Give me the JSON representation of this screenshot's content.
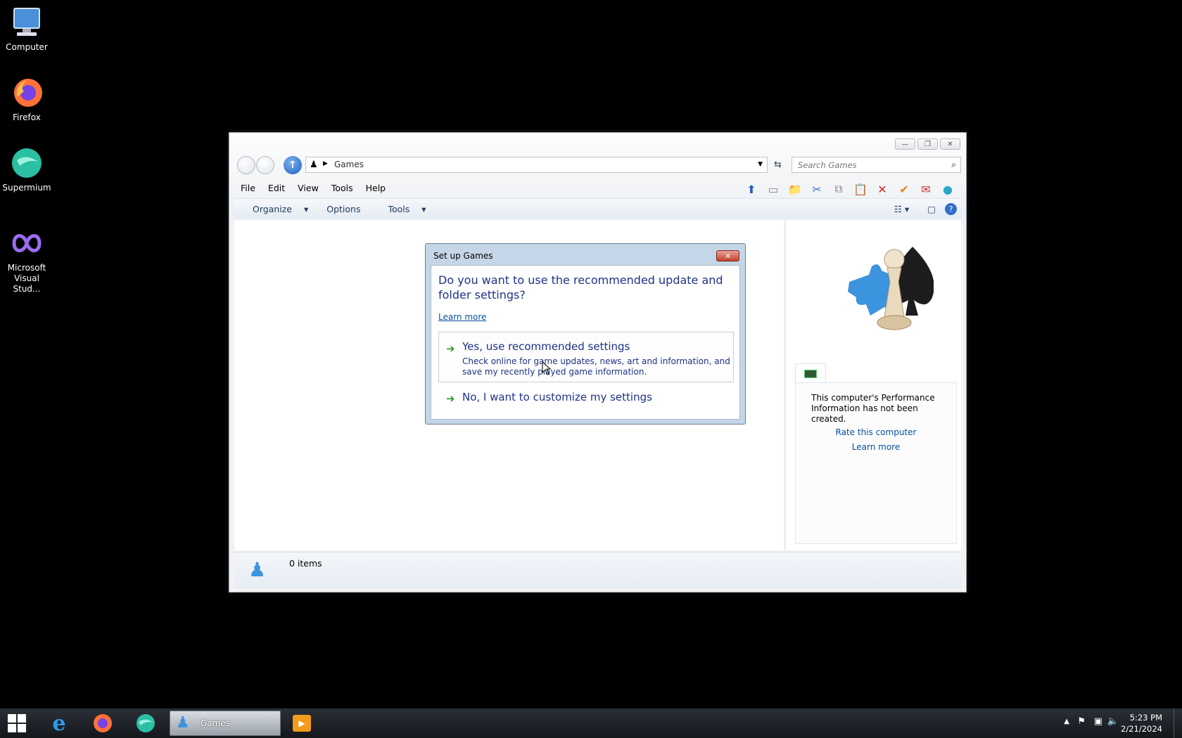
{
  "desktop": {
    "icons": [
      {
        "label": "Computer"
      },
      {
        "label": "Firefox"
      },
      {
        "label": "Supermium"
      },
      {
        "label": "Microsoft Visual Stud..."
      }
    ]
  },
  "window": {
    "address": {
      "crumb": "Games"
    },
    "search": {
      "placeholder": "Search Games"
    },
    "menu": [
      "File",
      "Edit",
      "View",
      "Tools",
      "Help"
    ],
    "commands": {
      "organize": "Organize",
      "options": "Options",
      "tools": "Tools"
    },
    "right_pane": {
      "info": "This computer's Performance Information has not been created.",
      "rate_link": "Rate this computer",
      "learn_link": "Learn more"
    },
    "status": {
      "items": "0 items"
    }
  },
  "dialog": {
    "title": "Set up Games",
    "question": "Do you want to use the recommended update and folder settings?",
    "learn_more": "Learn more",
    "option_yes": {
      "heading": "Yes, use recommended settings",
      "desc": "Check online for game updates, news, art and information, and save my recently played game information."
    },
    "option_no": {
      "heading": "No, I want to customize my settings"
    }
  },
  "taskbar": {
    "active_task": "Games",
    "time": "5:23 PM",
    "date": "2/21/2024"
  },
  "colors": {
    "link": "#0a4fa0",
    "dialog_text": "#1e3287",
    "accent_green": "#2f9c2f"
  }
}
